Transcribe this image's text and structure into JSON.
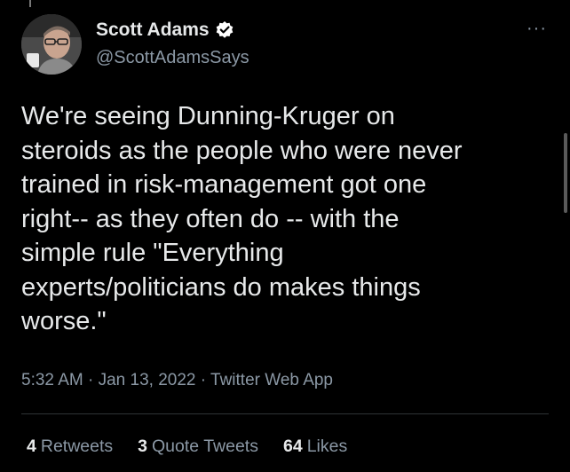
{
  "author": {
    "display_name": "Scott Adams",
    "handle": "@ScottAdamsSays",
    "verified": true,
    "avatar_icon": "profile-photo"
  },
  "tweet": {
    "text": "We're seeing Dunning-Kruger on\nsteroids as the people who were never\ntrained in risk-management got one\nright-- as they often do -- with the\nsimple rule \"Everything\nexperts/politicians do makes things\nworse.\"",
    "meta": "5:32 AM · Jan 13, 2022 · Twitter Web App"
  },
  "stats": {
    "retweets_count": "4",
    "retweets_label": "Retweets",
    "quotes_count": "3",
    "quotes_label": "Quote Tweets",
    "likes_count": "64",
    "likes_label": "Likes"
  },
  "colors": {
    "background": "#000000",
    "text": "#e7e9ea",
    "secondary_text": "#8b98a5",
    "divider": "#2f3336"
  },
  "icons": {
    "more": "more-options-icon",
    "verified": "verified-badge-icon"
  }
}
